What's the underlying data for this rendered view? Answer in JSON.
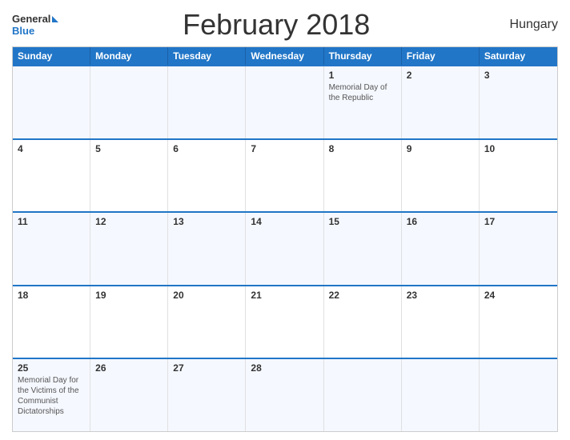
{
  "header": {
    "logo_general": "General",
    "logo_blue": "Blue",
    "title": "February 2018",
    "country": "Hungary"
  },
  "calendar": {
    "days_of_week": [
      "Sunday",
      "Monday",
      "Tuesday",
      "Wednesday",
      "Thursday",
      "Friday",
      "Saturday"
    ],
    "weeks": [
      [
        {
          "day": "",
          "holiday": ""
        },
        {
          "day": "",
          "holiday": ""
        },
        {
          "day": "",
          "holiday": ""
        },
        {
          "day": "",
          "holiday": ""
        },
        {
          "day": "1",
          "holiday": "Memorial Day of the Republic"
        },
        {
          "day": "2",
          "holiday": ""
        },
        {
          "day": "3",
          "holiday": ""
        }
      ],
      [
        {
          "day": "4",
          "holiday": ""
        },
        {
          "day": "5",
          "holiday": ""
        },
        {
          "day": "6",
          "holiday": ""
        },
        {
          "day": "7",
          "holiday": ""
        },
        {
          "day": "8",
          "holiday": ""
        },
        {
          "day": "9",
          "holiday": ""
        },
        {
          "day": "10",
          "holiday": ""
        }
      ],
      [
        {
          "day": "11",
          "holiday": ""
        },
        {
          "day": "12",
          "holiday": ""
        },
        {
          "day": "13",
          "holiday": ""
        },
        {
          "day": "14",
          "holiday": ""
        },
        {
          "day": "15",
          "holiday": ""
        },
        {
          "day": "16",
          "holiday": ""
        },
        {
          "day": "17",
          "holiday": ""
        }
      ],
      [
        {
          "day": "18",
          "holiday": ""
        },
        {
          "day": "19",
          "holiday": ""
        },
        {
          "day": "20",
          "holiday": ""
        },
        {
          "day": "21",
          "holiday": ""
        },
        {
          "day": "22",
          "holiday": ""
        },
        {
          "day": "23",
          "holiday": ""
        },
        {
          "day": "24",
          "holiday": ""
        }
      ],
      [
        {
          "day": "25",
          "holiday": "Memorial Day for the Victims of the Communist Dictatorships"
        },
        {
          "day": "26",
          "holiday": ""
        },
        {
          "day": "27",
          "holiday": ""
        },
        {
          "day": "28",
          "holiday": ""
        },
        {
          "day": "",
          "holiday": ""
        },
        {
          "day": "",
          "holiday": ""
        },
        {
          "day": "",
          "holiday": ""
        }
      ]
    ]
  }
}
